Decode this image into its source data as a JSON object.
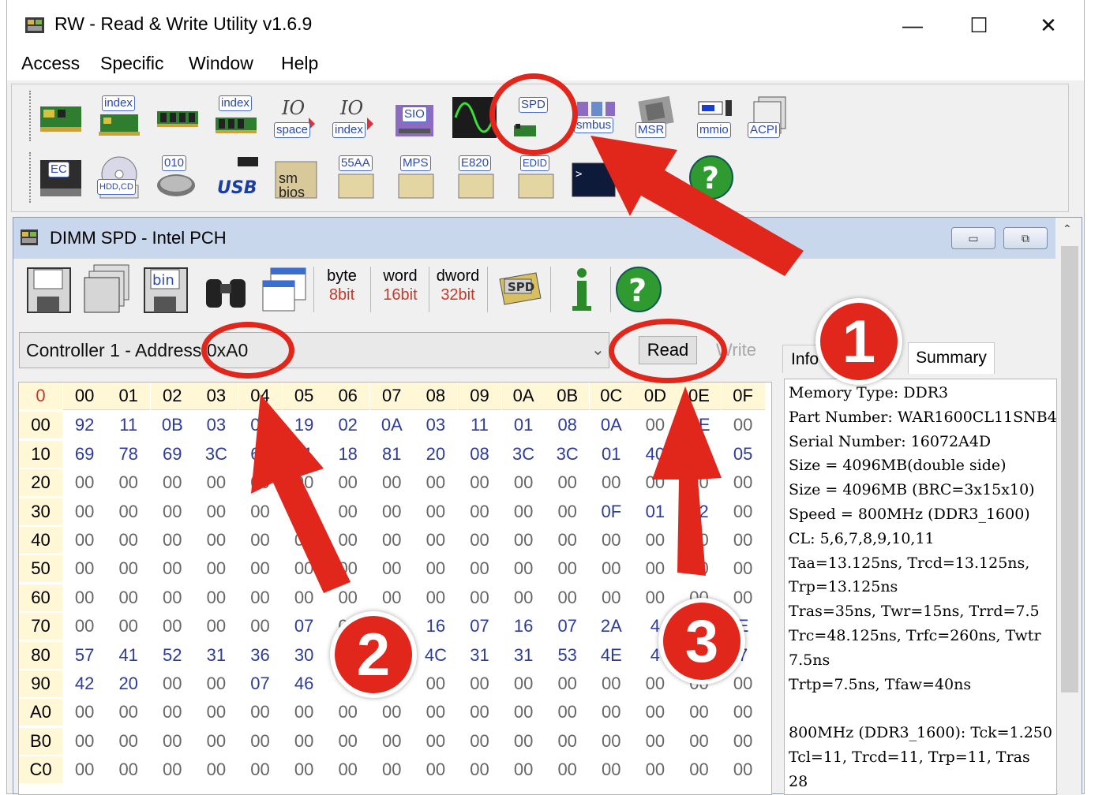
{
  "window": {
    "title": "RW - Read & Write Utility v1.6.9",
    "controls": {
      "minimize": "—",
      "maximize": "☐",
      "close": "✕"
    }
  },
  "menu": [
    "Access",
    "Specific",
    "Window",
    "Help"
  ],
  "toolbar": {
    "row1": [
      "pci",
      "index",
      "memory",
      "index",
      "space",
      "index",
      "SIO",
      "ac97",
      "SPD",
      "smbus",
      "MSR",
      "mmio",
      "ACPI"
    ],
    "row2": [
      "EC",
      "HDD,CD",
      "010",
      "USB",
      "sm bios",
      "55AA",
      "MPS",
      "E820",
      "EDID",
      "cmd",
      "help"
    ]
  },
  "child": {
    "title": "DIMM SPD - Intel PCH",
    "toolbar": {
      "bits": [
        {
          "unit": "byte",
          "bits": "8bit"
        },
        {
          "unit": "word",
          "bits": "16bit"
        },
        {
          "unit": "dword",
          "bits": "32bit"
        }
      ],
      "bin_label": "bin",
      "spd_label": "SPD"
    },
    "controller": "Controller 1 - Address 0xA0",
    "read": "Read",
    "write": "Write",
    "tabs": {
      "info": "Info",
      "summary": "Summary"
    }
  },
  "grid": {
    "corner": "0",
    "columns": [
      "00",
      "01",
      "02",
      "03",
      "04",
      "05",
      "06",
      "07",
      "08",
      "09",
      "0A",
      "0B",
      "0C",
      "0D",
      "0E",
      "0F"
    ],
    "rows": [
      {
        "label": "00",
        "cells": [
          "92",
          "11",
          "0B",
          "03",
          "04",
          "19",
          "02",
          "0A",
          "03",
          "11",
          "01",
          "08",
          "0A",
          "00",
          "FE",
          "00"
        ]
      },
      {
        "label": "10",
        "cells": [
          "69",
          "78",
          "69",
          "3C",
          "69",
          "11",
          "18",
          "81",
          "20",
          "08",
          "3C",
          "3C",
          "01",
          "40",
          "83",
          "05"
        ]
      },
      {
        "label": "20",
        "cells": [
          "00",
          "00",
          "00",
          "00",
          "00",
          "00",
          "00",
          "00",
          "00",
          "00",
          "00",
          "00",
          "00",
          "00",
          "00",
          "00"
        ]
      },
      {
        "label": "30",
        "cells": [
          "00",
          "00",
          "00",
          "00",
          "00",
          "00",
          "00",
          "00",
          "00",
          "00",
          "00",
          "00",
          "0F",
          "01",
          "02",
          "00"
        ]
      },
      {
        "label": "40",
        "cells": [
          "00",
          "00",
          "00",
          "00",
          "00",
          "00",
          "00",
          "00",
          "00",
          "00",
          "00",
          "00",
          "00",
          "00",
          "00",
          "00"
        ]
      },
      {
        "label": "50",
        "cells": [
          "00",
          "00",
          "00",
          "00",
          "00",
          "00",
          "00",
          "00",
          "00",
          "00",
          "00",
          "00",
          "00",
          "00",
          "00",
          "00"
        ]
      },
      {
        "label": "60",
        "cells": [
          "00",
          "00",
          "00",
          "00",
          "00",
          "00",
          "00",
          "00",
          "00",
          "00",
          "00",
          "00",
          "00",
          "00",
          "00",
          "00"
        ]
      },
      {
        "label": "70",
        "cells": [
          "00",
          "00",
          "00",
          "00",
          "00",
          "07",
          "00",
          "00",
          "16",
          "07",
          "16",
          "07",
          "2A",
          "4",
          "",
          "E"
        ]
      },
      {
        "label": "80",
        "cells": [
          "57",
          "41",
          "52",
          "31",
          "36",
          "30",
          "",
          "",
          "4C",
          "31",
          "31",
          "53",
          "4E",
          "4",
          "",
          "7"
        ]
      },
      {
        "label": "90",
        "cells": [
          "42",
          "20",
          "00",
          "00",
          "07",
          "46",
          "",
          "",
          "00",
          "00",
          "00",
          "00",
          "00",
          "00",
          "00",
          "00"
        ]
      },
      {
        "label": "A0",
        "cells": [
          "00",
          "00",
          "00",
          "00",
          "00",
          "00",
          "00",
          "00",
          "00",
          "00",
          "00",
          "00",
          "00",
          "00",
          "00",
          "00"
        ]
      },
      {
        "label": "B0",
        "cells": [
          "00",
          "00",
          "00",
          "00",
          "00",
          "00",
          "00",
          "00",
          "00",
          "00",
          "00",
          "00",
          "00",
          "00",
          "00",
          "00"
        ]
      },
      {
        "label": "C0",
        "cells": [
          "00",
          "00",
          "00",
          "00",
          "00",
          "00",
          "00",
          "00",
          "00",
          "00",
          "00",
          "00",
          "00",
          "00",
          "00",
          "00"
        ]
      }
    ]
  },
  "summary": {
    "lines": [
      "Memory Type: DDR3",
      "Part Number: WAR1600CL11SNB4G",
      "Serial Number: 16072A4D",
      "Size = 4096MB(double side)",
      "Size = 4096MB (BRC=3x15x10)",
      "Speed = 800MHz (DDR3_1600)",
      "CL: 5,6,7,8,9,10,11",
      "Taa=13.125ns, Trcd=13.125ns,",
      "Trp=13.125ns",
      "Tras=35ns, Twr=15ns, Trrd=7.5",
      "Trc=48.125ns, Trfc=260ns, Twtr",
      "7.5ns",
      "Trtp=7.5ns, Tfaw=40ns",
      "",
      "800MHz (DDR3_1600): Tck=1.250",
      " Tcl=11, Trcd=11, Trp=11, Tras",
      "28"
    ]
  },
  "annotations": {
    "badges": [
      "1",
      "2",
      "3"
    ],
    "color": "#e1261c"
  }
}
